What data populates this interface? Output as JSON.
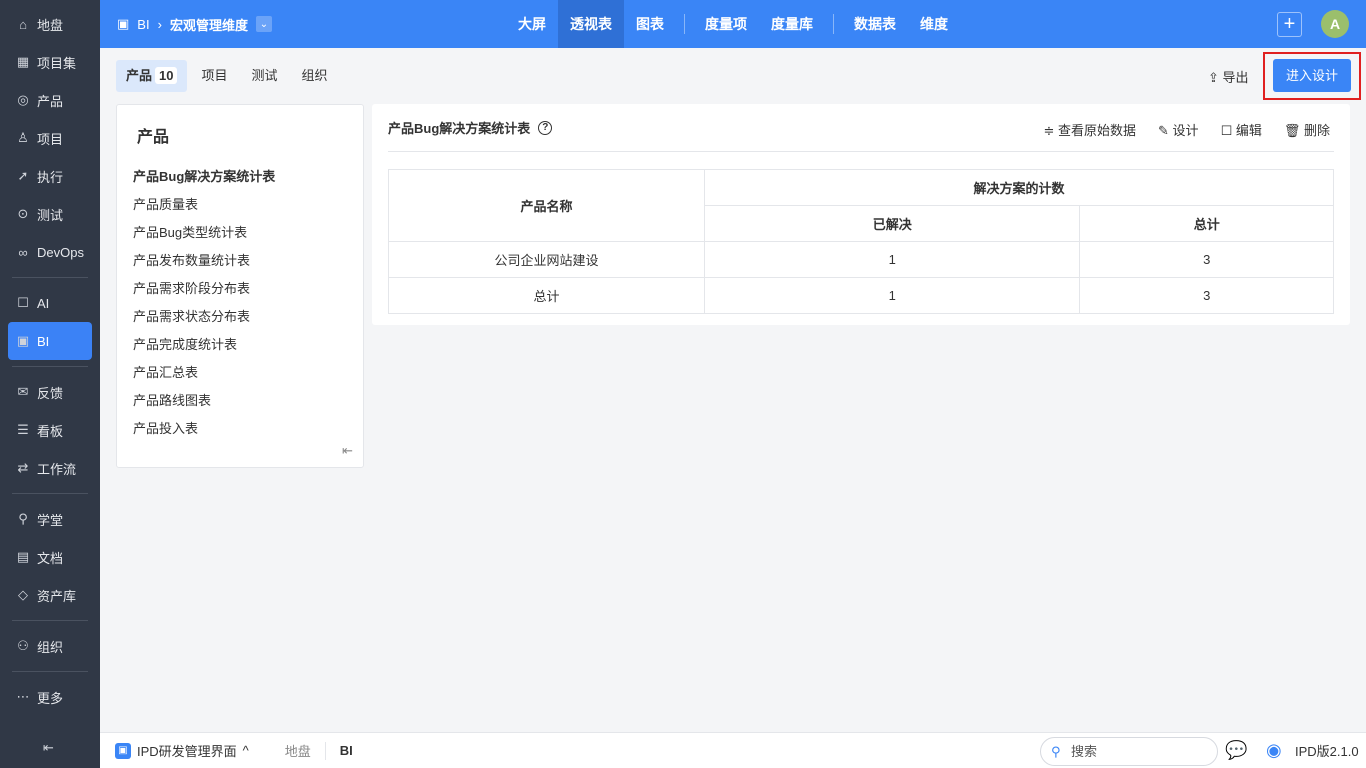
{
  "sidebar": {
    "items": [
      {
        "label": "地盘",
        "icon": "⌂"
      },
      {
        "label": "项目集",
        "icon": "▦"
      },
      {
        "label": "产品",
        "icon": "◎"
      },
      {
        "label": "项目",
        "icon": "♙"
      },
      {
        "label": "执行",
        "icon": "➚"
      },
      {
        "label": "测试",
        "icon": "⊙"
      },
      {
        "label": "DevOps",
        "icon": "∞"
      },
      {
        "label": "AI",
        "icon": "☐"
      },
      {
        "label": "BI",
        "icon": "▣"
      },
      {
        "label": "反馈",
        "icon": "✉"
      },
      {
        "label": "看板",
        "icon": "☰"
      },
      {
        "label": "工作流",
        "icon": "⇄"
      },
      {
        "label": "学堂",
        "icon": "⚲"
      },
      {
        "label": "文档",
        "icon": "▤"
      },
      {
        "label": "资产库",
        "icon": "◇"
      },
      {
        "label": "组织",
        "icon": "⚇"
      },
      {
        "label": "更多",
        "icon": "⋯"
      }
    ],
    "collapse": "⇤"
  },
  "header": {
    "module": "BI",
    "title": "宏观管理维度",
    "nav": [
      "大屏",
      "透视表",
      "图表",
      "度量项",
      "度量库",
      "数据表",
      "维度"
    ],
    "avatar": "A"
  },
  "tabs": [
    {
      "label": "产品",
      "count": "10"
    },
    {
      "label": "项目"
    },
    {
      "label": "测试"
    },
    {
      "label": "组织"
    }
  ],
  "toolbar": {
    "export": "导出",
    "design": "进入设计"
  },
  "left": {
    "title": "产品",
    "items": [
      "产品Bug解决方案统计表",
      "产品质量表",
      "产品Bug类型统计表",
      "产品发布数量统计表",
      "产品需求阶段分布表",
      "产品需求状态分布表",
      "产品完成度统计表",
      "产品汇总表",
      "产品路线图表",
      "产品投入表"
    ]
  },
  "report": {
    "title": "产品Bug解决方案统计表",
    "actions": [
      "查看原始数据",
      "设计",
      "编辑",
      "删除"
    ],
    "table": {
      "col1": "产品名称",
      "group": "解决方案的计数",
      "sub": [
        "已解决",
        "总计"
      ],
      "rows": [
        [
          "公司企业网站建设",
          "1",
          "3"
        ],
        [
          "总计",
          "1",
          "3"
        ]
      ]
    }
  },
  "footer": {
    "app": "IPD研发管理界面",
    "crumbs": [
      "地盘",
      "BI"
    ],
    "search_placeholder": "搜索",
    "version": "IPD版2.1.0"
  }
}
